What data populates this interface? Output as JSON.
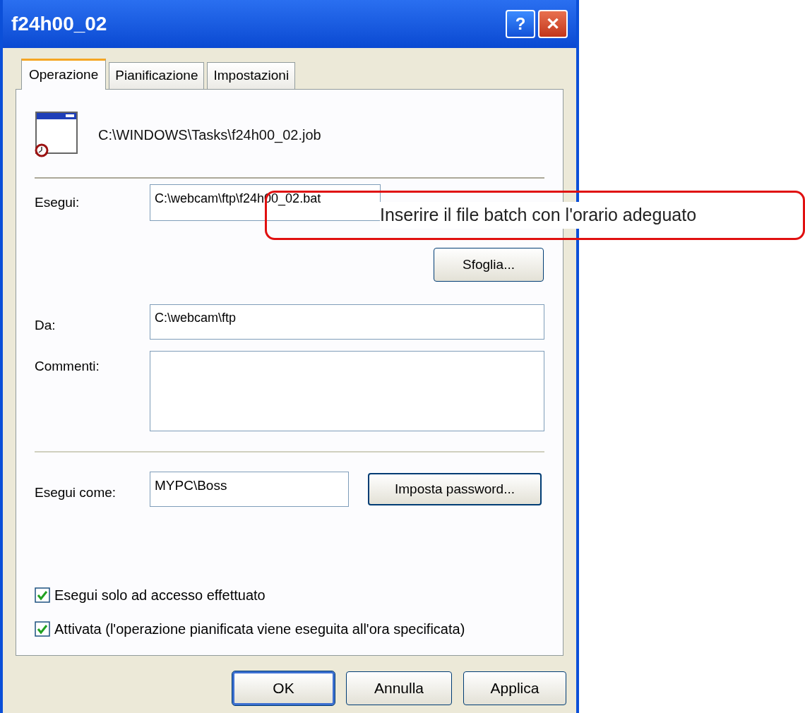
{
  "window": {
    "title": "f24h00_02"
  },
  "title_buttons": [
    {
      "kind": "help",
      "label": "?"
    },
    {
      "kind": "close",
      "label": "✕"
    }
  ],
  "tabs": [
    {
      "label": "Operazione",
      "selected": true
    },
    {
      "label": "Pianificazione",
      "selected": false
    },
    {
      "label": "Impostazioni",
      "selected": false
    }
  ],
  "task_path": "C:\\WINDOWS\\Tasks\\f24h00_02.job",
  "run": {
    "label": "Esegui:",
    "value": "C:\\webcam\\ftp\\f24h00_02.bat",
    "browse_button": "Sfoglia..."
  },
  "callout": {
    "text": "Inserire il file batch con l'orario adeguato"
  },
  "start_in": {
    "label": "Da:",
    "value": "C:\\webcam\\ftp"
  },
  "comments": {
    "label": "Commenti:"
  },
  "run_as": {
    "label": "Esegui come:",
    "value": "MYPC\\Boss",
    "password_button": "Imposta password..."
  },
  "checkboxes": [
    {
      "label": "Esegui solo ad accesso effettuato",
      "checked": true
    },
    {
      "label": "Attivata (l'operazione pianificata viene eseguita all'ora specificata)",
      "checked": true
    }
  ],
  "buttons": [
    {
      "label": "OK",
      "default": true
    },
    {
      "label": "Annulla",
      "default": false
    },
    {
      "label": "Applica",
      "default": false
    }
  ]
}
